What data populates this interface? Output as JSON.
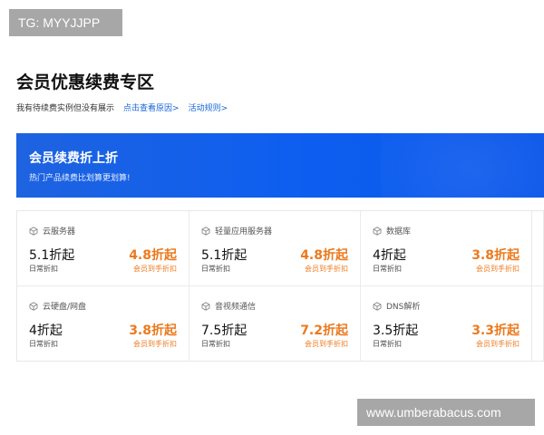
{
  "tag_badge": "TG: MYYJJPP",
  "page_title": "会员优惠续费专区",
  "notice": {
    "text": "我有待续费实例但没有展示",
    "link_reason": "点击查看原因>",
    "link_rules": "活动规则>"
  },
  "banner": {
    "title": "会员续费折上折",
    "subtitle": "热门产品续费比划算更划算!"
  },
  "daily_label": "日常折扣",
  "member_label": "会员到手折扣",
  "products": [
    {
      "name": "云服务器",
      "daily": "5.1折起",
      "member": "4.8折起"
    },
    {
      "name": "轻量应用服务器",
      "daily": "5.1折起",
      "member": "4.8折起"
    },
    {
      "name": "数据库",
      "daily": "4折起",
      "member": "3.8折起"
    },
    {
      "name": "云硬盘/网盘",
      "daily": "4折起",
      "member": "3.8折起"
    },
    {
      "name": "音视频通信",
      "daily": "7.5折起",
      "member": "7.2折起"
    },
    {
      "name": "DNS解析",
      "daily": "3.5折起",
      "member": "3.3折起"
    }
  ],
  "footer_badge": "www.umberabacus.com",
  "colors": {
    "accent_blue": "#1766d8",
    "banner_blue": "#0d5ef0",
    "member_orange": "#ec7a1f"
  }
}
